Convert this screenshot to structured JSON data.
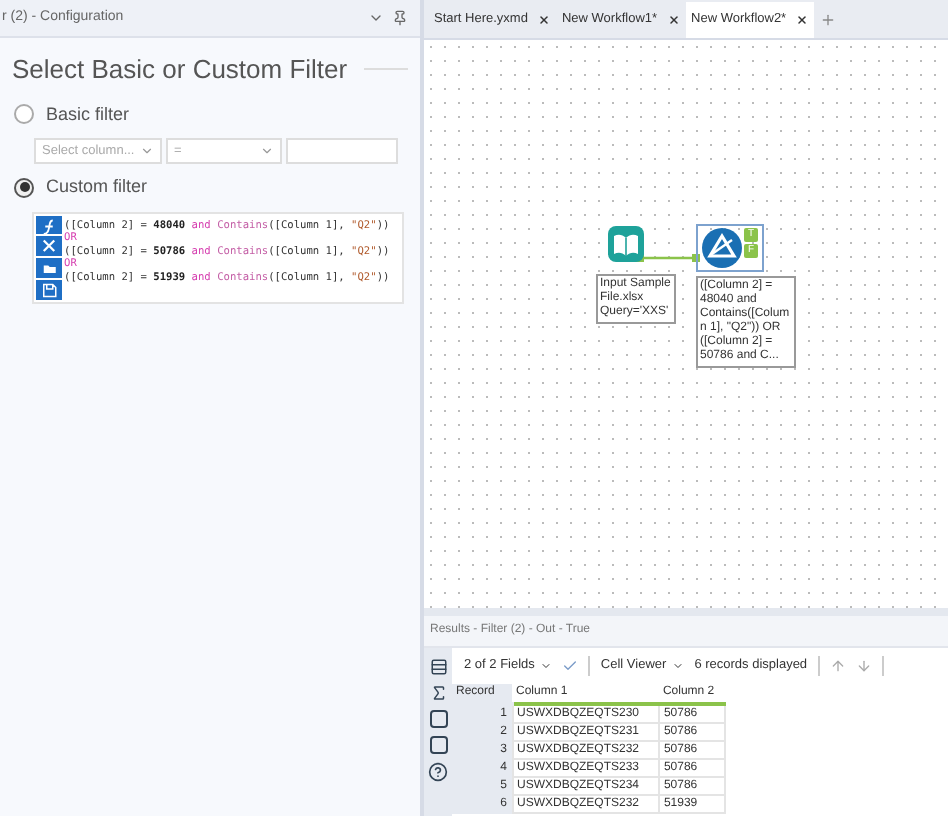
{
  "config_panel": {
    "title": "r (2) - Configuration",
    "heading": "Select Basic or Custom Filter",
    "filter_modes": [
      {
        "label": "Basic filter",
        "selected": false
      },
      {
        "label": "Custom filter",
        "selected": true
      }
    ],
    "basic_filter": {
      "column_placeholder": "Select column...",
      "operator": "="
    },
    "expression": [
      [
        {
          "kind": "plain",
          "text": "([Column 2] = "
        },
        {
          "kind": "number",
          "text": "48040"
        },
        {
          "kind": "keyword",
          "text": " and "
        },
        {
          "kind": "function",
          "text": "Contains"
        },
        {
          "kind": "plain",
          "text": "([Column 1], "
        },
        {
          "kind": "string",
          "text": "\"Q2\""
        },
        {
          "kind": "plain",
          "text": "))"
        }
      ],
      [
        {
          "kind": "keyword",
          "text": "OR"
        }
      ],
      [
        {
          "kind": "plain",
          "text": "([Column 2] = "
        },
        {
          "kind": "number",
          "text": "50786"
        },
        {
          "kind": "keyword",
          "text": " and "
        },
        {
          "kind": "function",
          "text": "Contains"
        },
        {
          "kind": "plain",
          "text": "([Column 1], "
        },
        {
          "kind": "string",
          "text": "\"Q2\""
        },
        {
          "kind": "plain",
          "text": "))"
        }
      ],
      [
        {
          "kind": "keyword",
          "text": "OR"
        }
      ],
      [
        {
          "kind": "plain",
          "text": "([Column 2] = "
        },
        {
          "kind": "number",
          "text": "51939"
        },
        {
          "kind": "keyword",
          "text": " and "
        },
        {
          "kind": "function",
          "text": "Contains"
        },
        {
          "kind": "plain",
          "text": "([Column 1], "
        },
        {
          "kind": "string",
          "text": "\"Q2\""
        },
        {
          "kind": "plain",
          "text": "))"
        }
      ]
    ]
  },
  "tabs": [
    {
      "label": "Start Here.yxmd",
      "selected": false
    },
    {
      "label": "New Workflow1*",
      "selected": false
    },
    {
      "label": "New Workflow2*",
      "selected": true
    }
  ],
  "canvas": {
    "nodes": [
      {
        "kind": "input",
        "label": "Input Sample File.xlsx Query='XXS'"
      },
      {
        "kind": "filter",
        "label": "([Column 2] = 48040 and Contains([Column 1], \"Q2\")) OR ([Column 2] = 50786 and C...",
        "anchors": [
          "T",
          "F"
        ]
      }
    ]
  },
  "results": {
    "title": "Results - Filter (2) - Out - True",
    "fields": "2 of 2 Fields",
    "viewer": "Cell Viewer",
    "count": "6 records displayed",
    "columns": [
      "Record",
      "Column 1",
      "Column 2"
    ],
    "rows": [
      [
        "1",
        "USWXDBQZEQTS230",
        "50786"
      ],
      [
        "2",
        "USWXDBQZEQTS231",
        "50786"
      ],
      [
        "3",
        "USWXDBQZEQTS232",
        "50786"
      ],
      [
        "4",
        "USWXDBQZEQTS233",
        "50786"
      ],
      [
        "5",
        "USWXDBQZEQTS234",
        "50786"
      ],
      [
        "6",
        "USWXDBQZEQTS232",
        "51939"
      ]
    ]
  }
}
